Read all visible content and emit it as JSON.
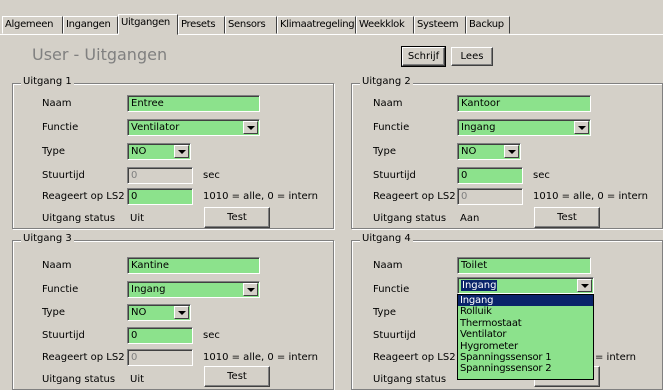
{
  "tabs": [
    "Algemeen",
    "Ingangen",
    "Uitgangen",
    "Presets",
    "Sensors",
    "Klimaatregeling",
    "Weekklok",
    "Systeem",
    "Backup"
  ],
  "active_tab": "Uitgangen",
  "page_title": "User - Uitgangen",
  "toolbar": {
    "write_label": "Schrijf",
    "read_label": "Lees"
  },
  "labels": {
    "name": "Naam",
    "function": "Functie",
    "type": "Type",
    "control_time": "Stuurtijd",
    "responds": "Reageert op LS2",
    "status": "Uitgang status",
    "sec": "sec",
    "hint": "1010 = alle, 0 = intern",
    "test": "Test"
  },
  "outputs": [
    {
      "title": "Uitgang 1",
      "name": "Entree",
      "function": "Ventilator",
      "type": "NO",
      "control_time": "0",
      "responds": "0",
      "status": "Uit"
    },
    {
      "title": "Uitgang 2",
      "name": "Kantoor",
      "function": "Ingang",
      "type": "NO",
      "control_time": "0",
      "responds": "0",
      "status": "Aan"
    },
    {
      "title": "Uitgang 3",
      "name": "Kantine",
      "function": "Ingang",
      "type": "NO",
      "control_time": "0",
      "responds": "0",
      "status": "Uit"
    },
    {
      "title": "Uitgang 4",
      "name": "Toilet",
      "function": "Ingang",
      "type": "",
      "control_time": "",
      "responds": "",
      "status": ""
    }
  ],
  "dropdown_options": [
    "Ingang",
    "Rolluik",
    "Thermostaat",
    "Ventilator",
    "Hygrometer",
    "Spanningssensor 1",
    "Spanningssensor 2"
  ],
  "colors": {
    "field_green": "#8ce28c",
    "face": "#d4d0c8",
    "selection": "#0a246a"
  }
}
